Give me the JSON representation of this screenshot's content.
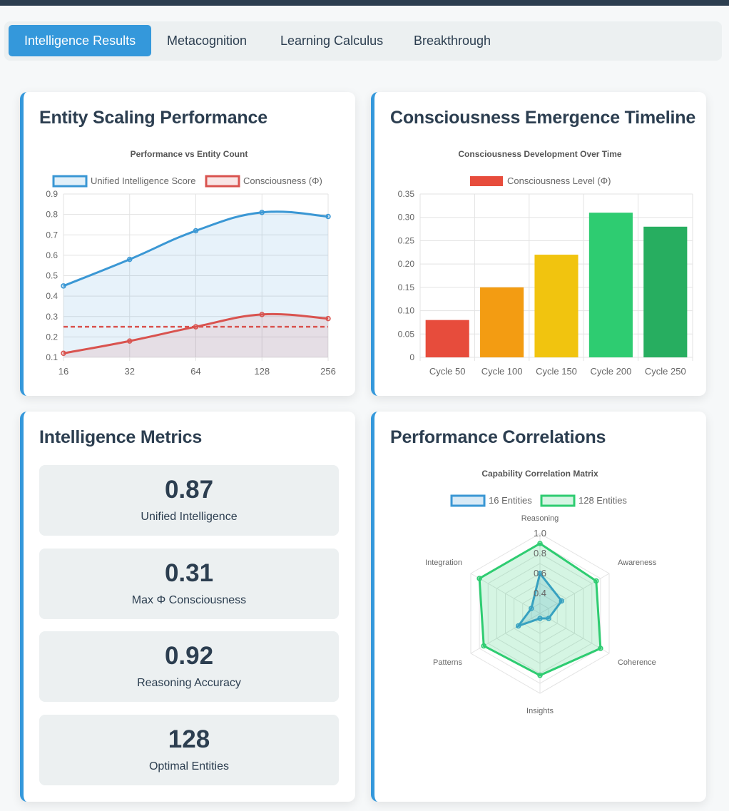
{
  "tabs": [
    {
      "label": "Intelligence Results",
      "active": true
    },
    {
      "label": "Metacognition",
      "active": false
    },
    {
      "label": "Learning Calculus",
      "active": false
    },
    {
      "label": "Breakthrough",
      "active": false
    }
  ],
  "cards": {
    "scaling_title": "Entity Scaling Performance",
    "timeline_title": "Consciousness Emergence Timeline",
    "metrics_title": "Intelligence Metrics",
    "correlations_title": "Performance Correlations"
  },
  "metrics": [
    {
      "value": "0.87",
      "label": "Unified Intelligence"
    },
    {
      "value": "0.31",
      "label": "Max Φ Consciousness"
    },
    {
      "value": "0.92",
      "label": "Reasoning Accuracy"
    },
    {
      "value": "128",
      "label": "Optimal Entities"
    }
  ],
  "colors": {
    "accent": "#3498db",
    "blue_series": "#3a97d4",
    "red_series": "#d9534f",
    "green_series": "#2ecc71",
    "dark": "#2c3e50",
    "panel": "#ecf0f1"
  },
  "chart_data": [
    {
      "type": "line",
      "title": "Performance vs Entity Count",
      "categories": [
        "16",
        "32",
        "64",
        "128",
        "256"
      ],
      "series": [
        {
          "name": "Unified Intelligence Score",
          "values": [
            0.45,
            0.58,
            0.72,
            0.81,
            0.79
          ],
          "color": "#3a97d4"
        },
        {
          "name": "Consciousness (Φ)",
          "values": [
            0.12,
            0.18,
            0.25,
            0.31,
            0.29
          ],
          "color": "#d9534f"
        }
      ],
      "threshold": 0.25,
      "ylim": [
        0.1,
        0.9
      ],
      "yticks": [
        "0.1",
        "0.2",
        "0.3",
        "0.4",
        "0.5",
        "0.6",
        "0.7",
        "0.8",
        "0.9"
      ],
      "legend": "top",
      "grid": true
    },
    {
      "type": "bar",
      "title": "Consciousness Development Over Time",
      "categories": [
        "Cycle 50",
        "Cycle 100",
        "Cycle 150",
        "Cycle 200",
        "Cycle 250"
      ],
      "series": [
        {
          "name": "Consciousness Level (Φ)",
          "values": [
            0.08,
            0.15,
            0.22,
            0.31,
            0.28
          ]
        }
      ],
      "bar_colors": [
        "#e74c3c",
        "#f39c12",
        "#f1c40f",
        "#2ecc71",
        "#27ae60"
      ],
      "legend_color": "#e74c3c",
      "ylim": [
        0,
        0.35
      ],
      "yticks": [
        "0",
        "0.05",
        "0.10",
        "0.15",
        "0.20",
        "0.25",
        "0.30",
        "0.35"
      ],
      "legend": "top",
      "grid": true
    },
    {
      "type": "radar",
      "title": "Capability Correlation Matrix",
      "axes": [
        "Reasoning",
        "Awareness",
        "Coherence",
        "Insights",
        "Patterns",
        "Integration"
      ],
      "series": [
        {
          "name": "16 Entities",
          "values": [
            0.6,
            0.45,
            0.3,
            0.25,
            0.45,
            0.3
          ],
          "color": "#3a97d4"
        },
        {
          "name": "128 Entities",
          "values": [
            0.9,
            0.85,
            0.9,
            0.82,
            0.85,
            0.9
          ],
          "color": "#2ecc71"
        }
      ],
      "rmin": 0.2,
      "rmax": 1.0,
      "rticks": [
        "0.4",
        "0.6",
        "0.8",
        "1.0"
      ],
      "legend": "top"
    }
  ]
}
